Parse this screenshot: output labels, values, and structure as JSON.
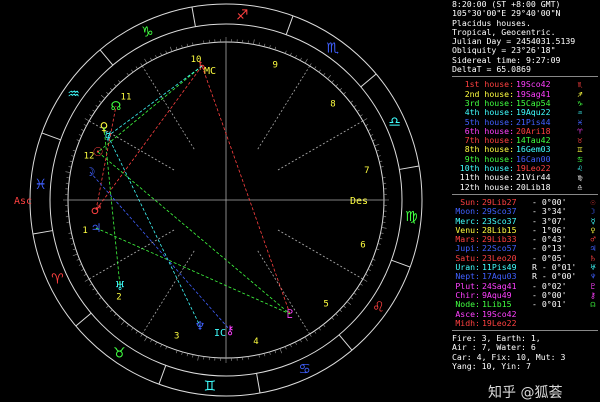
{
  "header": {
    "time_line": "8:20:00 (ST +8:00 GMT)",
    "coord_line": "105°30'00\"E 29°40'00\"N",
    "house_system": "Placidus houses.",
    "zodiac": "Tropical, Geocentric.",
    "julian_day": "Julian Day = 2454031.5139",
    "obliquity": "Obliquity = 23°26'18\"",
    "sidereal": "Sidereal time: 9:27:09",
    "delta_t": "DeltaT = 65.0869"
  },
  "houses": [
    {
      "label": "1st house:",
      "value": "19Sco42",
      "glyph": "♏",
      "label_color": "#ff4040",
      "value_color": "#ff40ff"
    },
    {
      "label": "2nd house:",
      "value": "19Sag41",
      "glyph": "♐",
      "label_color": "#ffff40",
      "value_color": "#ff40ff"
    },
    {
      "label": "3rd house:",
      "value": "15Cap54",
      "glyph": "♑",
      "label_color": "#40ff40",
      "value_color": "#40ff40"
    },
    {
      "label": "4th house:",
      "value": "19Aqu22",
      "glyph": "♒",
      "label_color": "#40ffff",
      "value_color": "#40ffff"
    },
    {
      "label": "5th house:",
      "value": "21Pis44",
      "glyph": "♓",
      "label_color": "#4060ff",
      "value_color": "#4060ff"
    },
    {
      "label": "6th house:",
      "value": "20Ari18",
      "glyph": "♈",
      "label_color": "#ff40ff",
      "value_color": "#ff4040"
    },
    {
      "label": "7th house:",
      "value": "14Tau42",
      "glyph": "♉",
      "label_color": "#ff4040",
      "value_color": "#40ff40"
    },
    {
      "label": "8th house:",
      "value": "16Gem03",
      "glyph": "♊",
      "label_color": "#ffff40",
      "value_color": "#40ffff"
    },
    {
      "label": "9th house:",
      "value": "16Can00",
      "glyph": "♋",
      "label_color": "#40ff40",
      "value_color": "#4060ff"
    },
    {
      "label": "10th house:",
      "value": "19Leo22",
      "glyph": "♌",
      "label_color": "#40ffff",
      "value_color": "#ff4040"
    },
    {
      "label": "11th house:",
      "value": "21Vir44",
      "glyph": "♍",
      "label_color": "#ffffff",
      "value_color": "#ffffff"
    },
    {
      "label": "12th house:",
      "value": "20Lib18",
      "glyph": "♎",
      "label_color": "#ffffff",
      "value_color": "#ffffff"
    }
  ],
  "planets": [
    {
      "name": "Sun:",
      "value": "29Lib27",
      "speed": "- 0°00'",
      "glyph": "☉",
      "color": "#ff4040"
    },
    {
      "name": "Moon:",
      "value": "29Sco37",
      "speed": "- 3°34'",
      "glyph": "☽",
      "color": "#4060ff"
    },
    {
      "name": "Merc:",
      "value": "23Sco37",
      "speed": "- 3°07'",
      "glyph": "☿",
      "color": "#40ffff"
    },
    {
      "name": "Venu:",
      "value": "28Lib15",
      "speed": "- 1°06'",
      "glyph": "♀",
      "color": "#ffff40"
    },
    {
      "name": "Mars:",
      "value": "29Lib33",
      "speed": "- 0°43'",
      "glyph": "♂",
      "color": "#ff4040"
    },
    {
      "name": "Jupi:",
      "value": "22Sco57",
      "speed": "- 0°13'",
      "glyph": "♃",
      "color": "#4060ff"
    },
    {
      "name": "Satu:",
      "value": "23Leo20",
      "speed": "- 0°05'",
      "glyph": "♄",
      "color": "#ff4040"
    },
    {
      "name": "Uran:",
      "value": "11Pis49",
      "speed": "R - 0°01'",
      "glyph": "♅",
      "color": "#40ffff"
    },
    {
      "name": "Nept:",
      "value": "17Aqu03",
      "speed": "R - 0°00'",
      "glyph": "♆",
      "color": "#4060ff"
    },
    {
      "name": "Plut:",
      "value": "24Sag41",
      "speed": "- 0°02'",
      "glyph": "♇",
      "color": "#ff40ff"
    },
    {
      "name": "Chir:",
      "value": "9Aqu49",
      "speed": "- 0°00'",
      "glyph": "⚷",
      "color": "#ff40ff"
    },
    {
      "name": "Node:",
      "value": "1Lib15",
      "speed": "- 0°01'",
      "glyph": "☊",
      "color": "#40ff40"
    },
    {
      "name": "Asce:",
      "value": "19Sco42",
      "speed": "",
      "glyph": "",
      "color": "#ff40ff"
    },
    {
      "name": "Midh:",
      "value": "19Leo22",
      "speed": "",
      "glyph": "",
      "color": "#ff4040"
    }
  ],
  "elements": [
    "Fire: 3, Earth: 1,",
    "Air : 7, Water: 6",
    "Car: 4, Fix: 10, Mut: 3",
    "Yang: 10, Yin: 7"
  ],
  "watermark": "知乎 @狐荟",
  "wheel": {
    "signs": [
      "♈",
      "♉",
      "♊",
      "♋",
      "♌",
      "♍",
      "♎",
      "♏",
      "♐",
      "♑",
      "♒",
      "♓"
    ],
    "sign_colors": [
      "#ff4040",
      "#40ff40",
      "#40ffff",
      "#4060ff",
      "#ff4040",
      "#40ff40",
      "#40ffff",
      "#4060ff",
      "#ff4040",
      "#40ff40",
      "#40ffff",
      "#4060ff"
    ],
    "house_numbers": [
      "1",
      "2",
      "3",
      "4",
      "5",
      "6",
      "7",
      "8",
      "9",
      "10",
      "11",
      "12"
    ],
    "asc_label": "Asc",
    "des_label": "Des",
    "mc_label": "MC",
    "ic_label": "IC"
  },
  "colors": {
    "red": "#ff4040",
    "yellow": "#ffff40",
    "green": "#40ff40",
    "cyan": "#40ffff",
    "blue": "#4060ff",
    "magenta": "#ff40ff"
  }
}
